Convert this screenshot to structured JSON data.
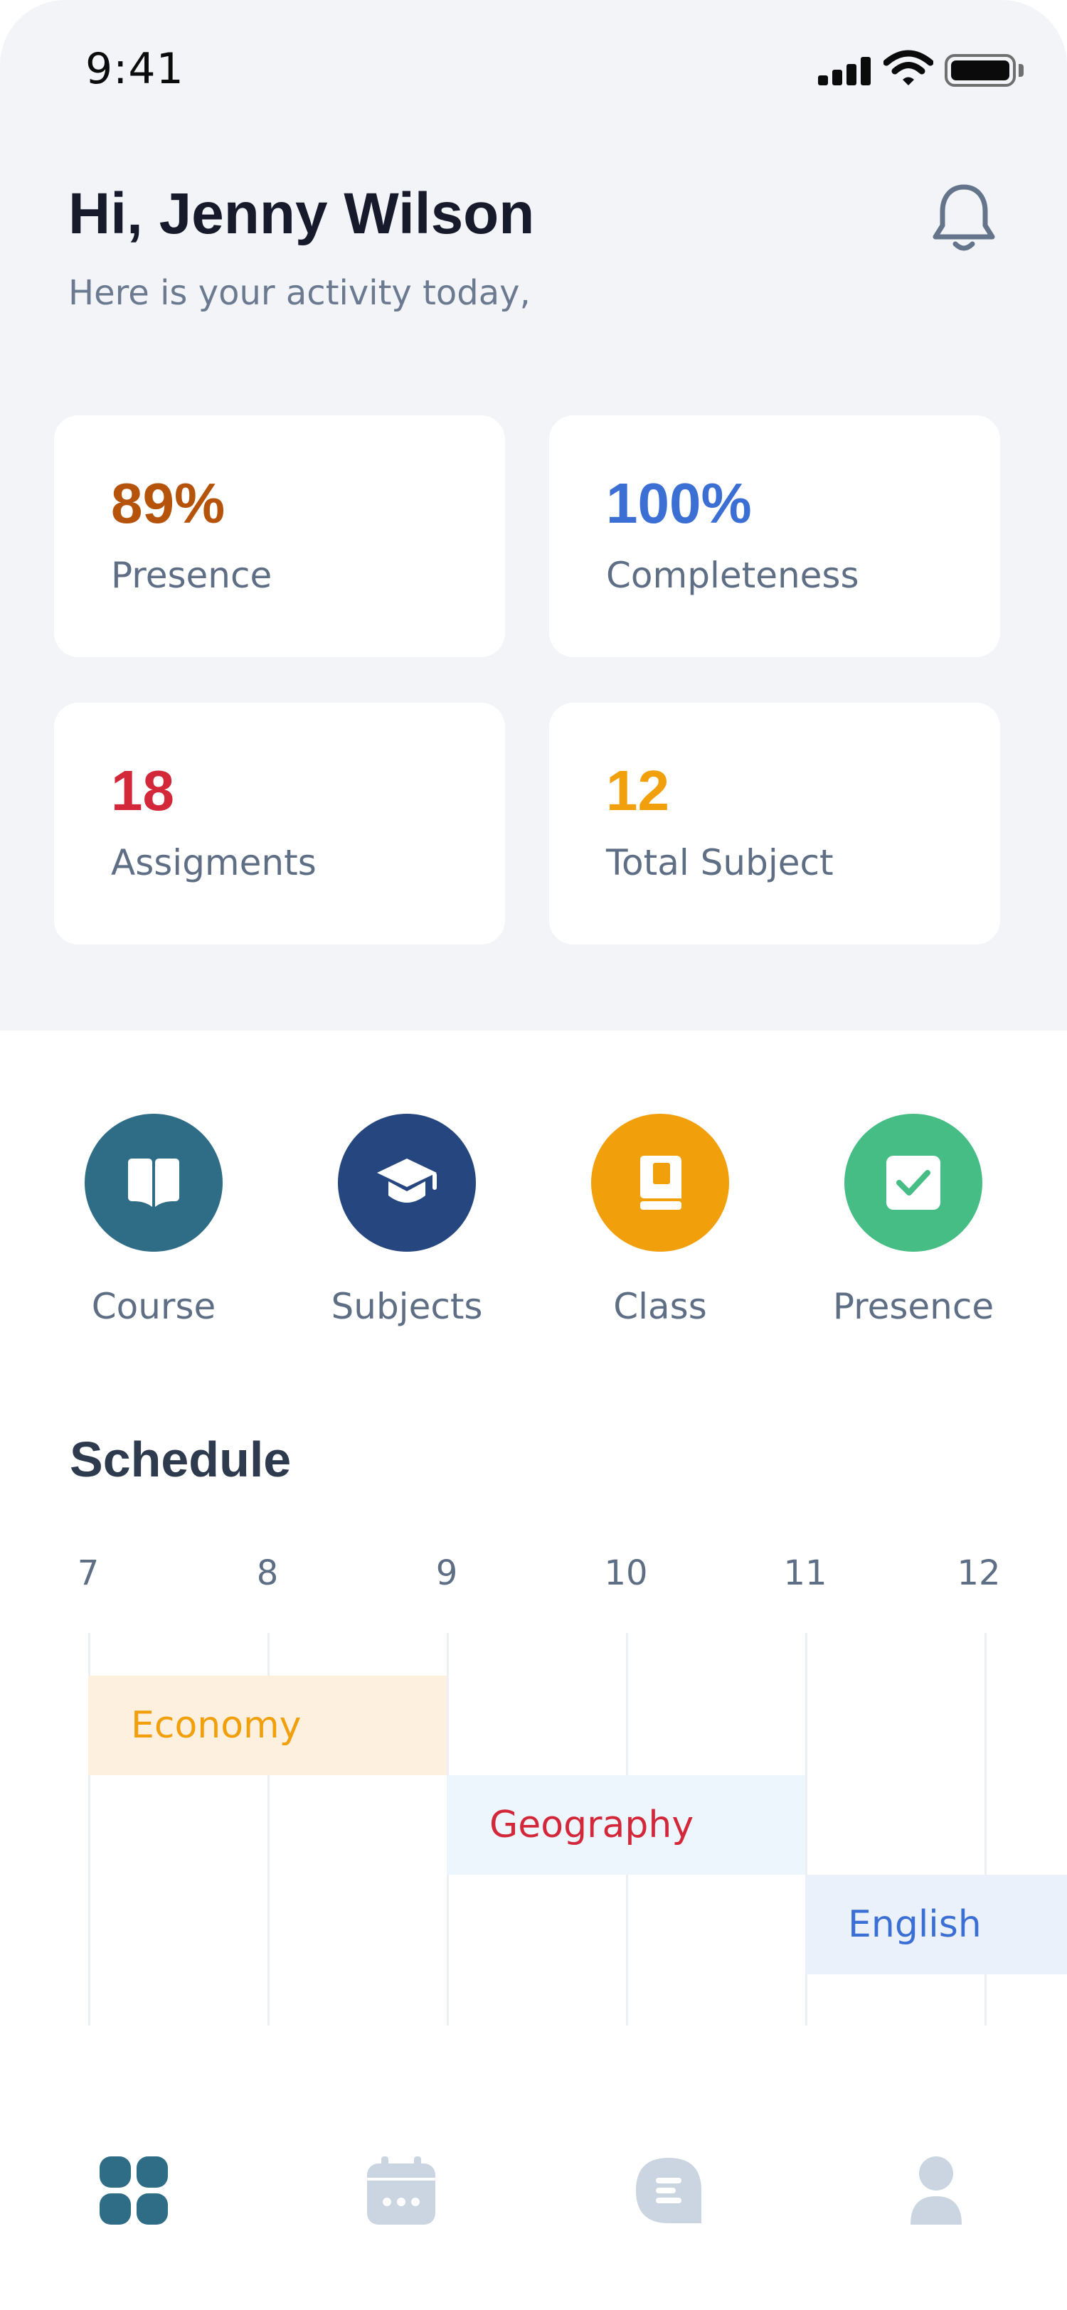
{
  "status_bar": {
    "time": "9:41"
  },
  "header": {
    "greeting": "Hi, Jenny Wilson",
    "subtitle": "Here is your activity today,"
  },
  "stats": [
    {
      "value": "89%",
      "label": "Presence",
      "color": "#b45309"
    },
    {
      "value": "100%",
      "label": "Completeness",
      "color": "#3b6fd4"
    },
    {
      "value": "18",
      "label": "Assigments",
      "color": "#d3283a"
    },
    {
      "value": "12",
      "label": "Total Subject",
      "color": "#f29f0c"
    }
  ],
  "actions": [
    {
      "label": "Course",
      "icon": "book-icon",
      "color": "#2f6d87"
    },
    {
      "label": "Subjects",
      "icon": "graduation-cap-icon",
      "color": "#26467f"
    },
    {
      "label": "Class",
      "icon": "notebook-icon",
      "color": "#f29f0c"
    },
    {
      "label": "Presence",
      "icon": "checkbox-icon",
      "color": "#46bd84"
    }
  ],
  "schedule": {
    "title": "Schedule",
    "hours": [
      "7",
      "8",
      "9",
      "10",
      "11",
      "12"
    ],
    "events": [
      {
        "name": "Economy",
        "start": 7,
        "end": 9,
        "text_color": "#f29f0c",
        "bg_color": "#fdf0de"
      },
      {
        "name": "Geography",
        "start": 9,
        "end": 11,
        "text_color": "#d3283a",
        "bg_color": "#eef6fd"
      },
      {
        "name": "English",
        "start": 11,
        "end": 12.5,
        "text_color": "#3b6fd4",
        "bg_color": "#eaf1fb"
      }
    ]
  },
  "bottom_nav": [
    {
      "icon": "dashboard-icon",
      "active": true
    },
    {
      "icon": "calendar-icon",
      "active": false
    },
    {
      "icon": "chat-icon",
      "active": false
    },
    {
      "icon": "profile-icon",
      "active": false
    }
  ],
  "colors": {
    "active_nav": "#2f6d87",
    "inactive_nav": "#cbd5e1"
  }
}
